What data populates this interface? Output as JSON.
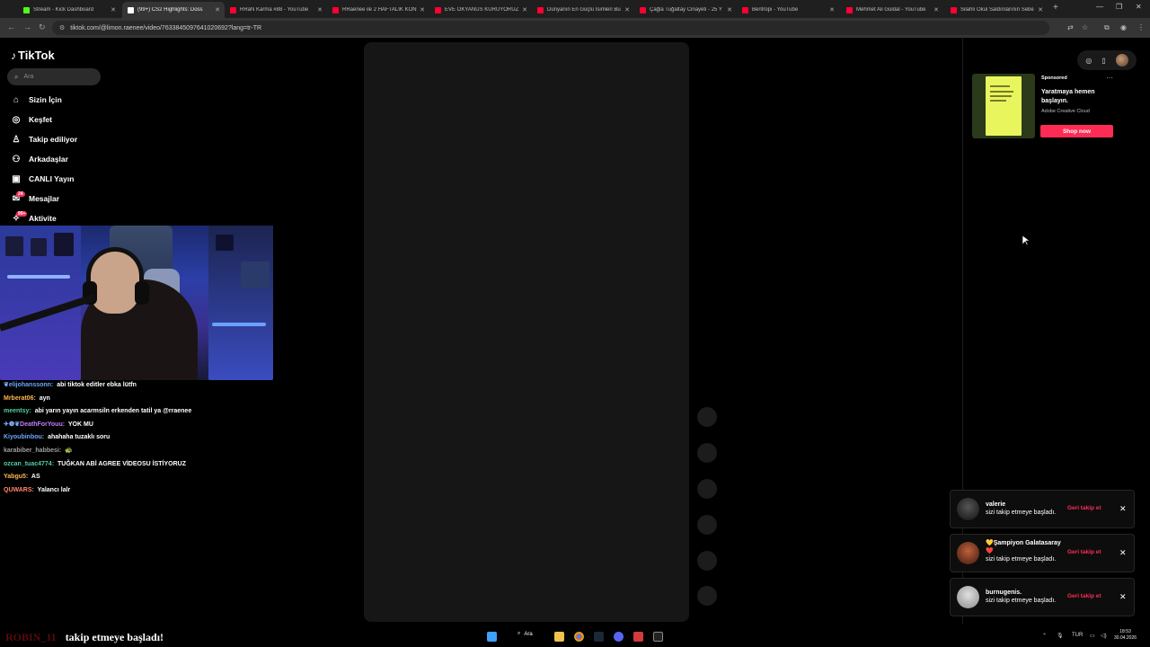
{
  "browser": {
    "tabs": [
      {
        "title": "Stream - Kick Dashboard",
        "color": "#53fc18"
      },
      {
        "title": "(99+) CS2 Highlights: Doss",
        "color": "#ffffff",
        "active": true
      },
      {
        "title": "RRaN Karma #88 - YouTube",
        "color": "#ff0033"
      },
      {
        "title": "RRaenee ile 2 HAFTALIK KON",
        "color": "#ff0033"
      },
      {
        "title": "EVE OKYANUS KURUYORUZ (l",
        "color": "#ff0033"
      },
      {
        "title": "Dünyanın En Güçlü İsimleri Bu",
        "color": "#ff0033"
      },
      {
        "title": "Çağla Tuğaltay Cinayeti - 25 Y",
        "color": "#ff0033"
      },
      {
        "title": "Bentropi - YouTube",
        "color": "#ff0033"
      },
      {
        "title": "Mehmet Ali Güldal - YouTube",
        "color": "#ff0033"
      },
      {
        "title": "Silahlı Okul Saldırılarının Sebe",
        "color": "#ff0033"
      }
    ],
    "new_tab": "+",
    "minimize": "—",
    "maximize": "❐",
    "close": "✕",
    "back": "←",
    "forward": "→",
    "reload": "↻",
    "url": "tiktok.com/@limon.raenee/video/7633845097641020692?lang=tr-TR"
  },
  "tiktok": {
    "logo": "TikTok",
    "search_placeholder": "Ara",
    "nav": [
      {
        "label": "Sizin İçin",
        "icon": "home-icon"
      },
      {
        "label": "Keşfet",
        "icon": "compass-icon"
      },
      {
        "label": "Takip ediliyor",
        "icon": "following-icon"
      },
      {
        "label": "Arkadaşlar",
        "icon": "friends-icon"
      },
      {
        "label": "CANLI Yayın",
        "icon": "live-icon"
      },
      {
        "label": "Mesajlar",
        "icon": "messages-icon",
        "badge": "24"
      },
      {
        "label": "Aktivite",
        "icon": "activity-icon",
        "badge": "99+"
      }
    ]
  },
  "chat": [
    {
      "user": "elijohanssonn:",
      "user_color": "#6fa8ff",
      "msg": "abi tiktok editler ebka lütfn",
      "prefix": "❦"
    },
    {
      "user": "Mrberat06:",
      "user_color": "#ffb74d",
      "msg": "ayn",
      "prefix": ""
    },
    {
      "user": "meentsy:",
      "user_color": "#4dd0a5",
      "msg": "abi yarın yayın acarmsiln erkenden tatil ya @rraenee",
      "prefix": ""
    },
    {
      "user": "DeathForYouu:",
      "user_color": "#c77dff",
      "msg": "YOK MU",
      "prefix": "✈❶❦"
    },
    {
      "user": "Kiyoubinbou:",
      "user_color": "#6fa8ff",
      "msg": "ahahaha tuzaklı soru",
      "prefix": ""
    },
    {
      "user": "karabiber_habbesi:",
      "user_color": "#a0a0a0",
      "msg": "🐢",
      "prefix": ""
    },
    {
      "user": "ozcan_tuac4774:",
      "user_color": "#4dd0a5",
      "msg": "TUĞKAN ABİ AGREE VİDEOSU İSTİYORUZ",
      "prefix": ""
    },
    {
      "user": "Yabgu5:",
      "user_color": "#ffb74d",
      "msg": "AS",
      "prefix": ""
    },
    {
      "user": "QUWARS:",
      "user_color": "#ff8a65",
      "msg": "Yalancı lalr",
      "prefix": ""
    }
  ],
  "ad": {
    "sponsored": "Sponsored",
    "more": "···",
    "title": "Yaratmaya hemen başlayın.",
    "subtitle": "Adobe Creative Cloud",
    "cta": "Shop now"
  },
  "notifications": [
    {
      "name": "valerie",
      "text": "sizi takip etmeye başladı.",
      "action": "Geri takip et",
      "close": "✕"
    },
    {
      "name": "💛Şampiyon Galatasaray ❤️",
      "text": "sizi takip etmeye başladı.",
      "action": "Geri takip et",
      "close": "✕"
    },
    {
      "name": "burnugenis.",
      "text": "sizi takip etmeye başladı.",
      "action": "Geri takip et",
      "close": "✕"
    }
  ],
  "overlay": {
    "hidden_name": "ROBIN_11",
    "text": "takip etmeye başladı!"
  },
  "taskbar": {
    "search": "Ara",
    "lang": "TUR",
    "time": "18:53",
    "date": "30.04.2026"
  }
}
